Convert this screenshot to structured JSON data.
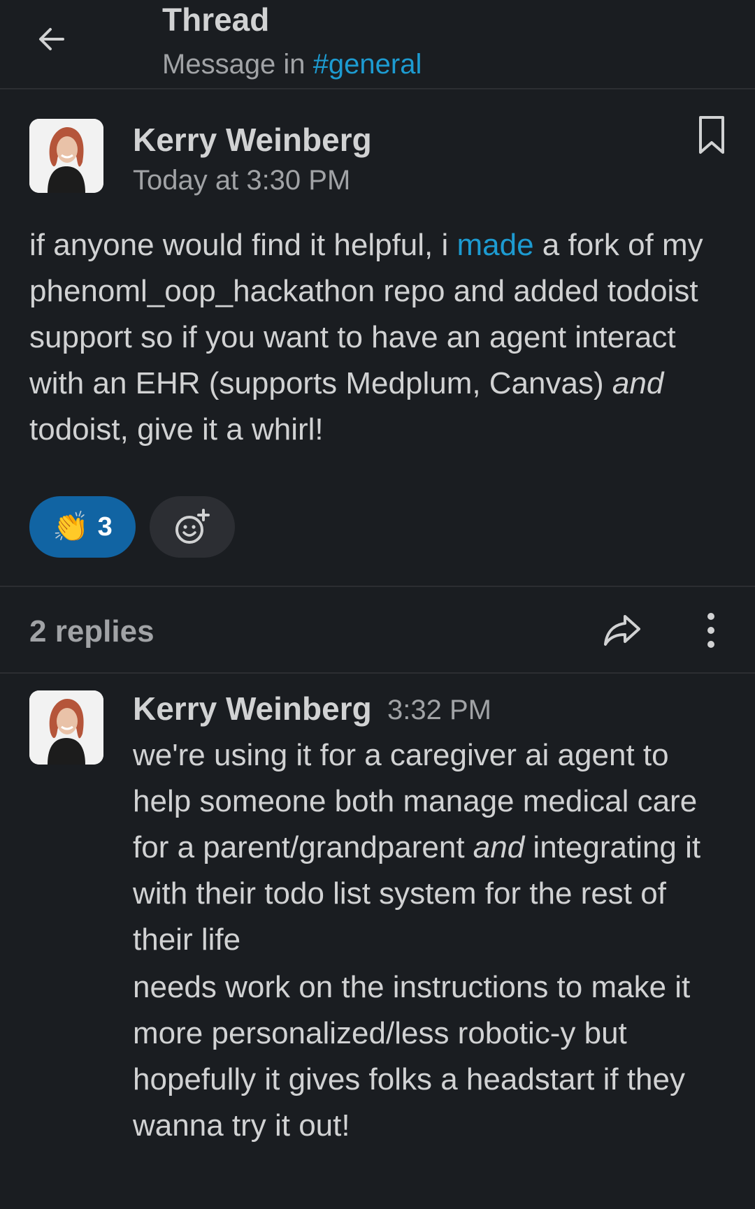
{
  "header": {
    "title": "Thread",
    "subtitle_prefix": "Message in",
    "channel": "#general"
  },
  "message": {
    "author": "Kerry Weinberg",
    "time": "Today at 3:30 PM",
    "text_1": "if anyone would find it helpful, i ",
    "link": "made",
    "text_2": " a fork of my phenoml_oop_hackathon repo and added todoist support so if you want to have an agent interact with an EHR (supports Medplum, Canvas) ",
    "emph": "and",
    "text_3": " todoist, give it a whirl!",
    "reaction": {
      "emoji": "👏",
      "count": "3"
    }
  },
  "replies": {
    "count_label": "2 replies"
  },
  "reply": {
    "author": "Kerry Weinberg",
    "time": "3:32 PM",
    "p1_a": "we're using it for a caregiver ai agent to help someone both manage medical care for a parent/grandparent ",
    "p1_emph": "and",
    "p1_b": " integrating it with their todo list system for the rest of their life",
    "p2": "needs work on the instructions to make it more personalized/less robotic-y but hopefully it gives folks a headstart if they wanna try it out!"
  },
  "colors": {
    "background": "#1a1d21",
    "link": "#1d9bd1",
    "reaction_bg": "#1164a3"
  },
  "icons": [
    "back-arrow-icon",
    "bookmark-icon",
    "add-emoji-icon",
    "share-icon",
    "more-vertical-icon"
  ]
}
